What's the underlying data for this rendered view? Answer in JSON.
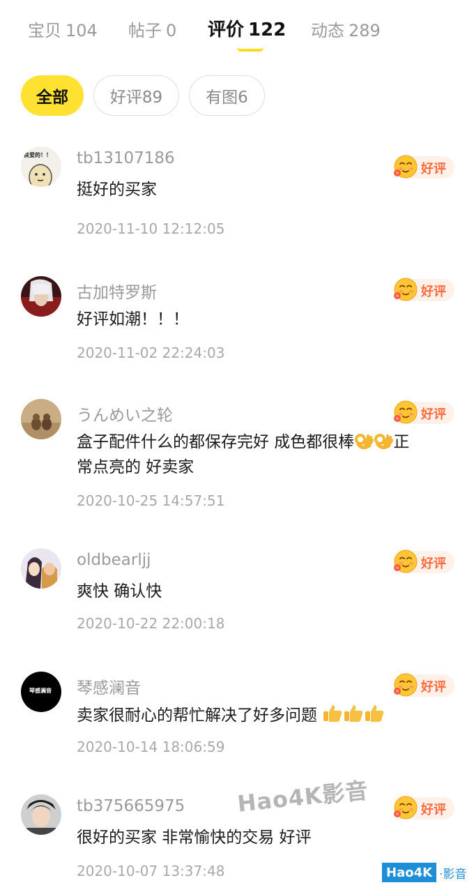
{
  "tabs": [
    {
      "label": "宝贝",
      "count": "104"
    },
    {
      "label": "帖子",
      "count": "0"
    },
    {
      "label": "评价",
      "count": "122"
    },
    {
      "label": "动态",
      "count": "289"
    }
  ],
  "active_tab": "评价",
  "filters": [
    {
      "label": "全部"
    },
    {
      "label": "好评89"
    },
    {
      "label": "有图6"
    }
  ],
  "reviews": [
    {
      "username": "tb13107186",
      "content": "挺好的买家",
      "date": "2020-11-10 12:12:05",
      "badge": "好评",
      "avatar_text": "良爱的！！"
    },
    {
      "username": "古加特罗斯",
      "content": "好评如潮！！！",
      "date": "2020-11-02 22:24:03",
      "badge": "好评"
    },
    {
      "username": "うんめい之轮",
      "content_line1": "盒子配件什么的都保存完好 成色都很棒",
      "content_line1_end": "正",
      "content_line2": "常点亮的 好卖家",
      "date": "2020-10-25 14:57:51",
      "badge": "好评"
    },
    {
      "username": "oldbearljj",
      "content": "爽快 确认快",
      "date": "2020-10-22 22:00:18",
      "badge": "好评"
    },
    {
      "username": "琴感澜音",
      "content": "卖家很耐心的帮忙解决了好多问题",
      "date": "2020-10-14 18:06:59",
      "badge": "好评",
      "avatar_text": "琴感澜音"
    },
    {
      "username": "tb375665975",
      "content": "很好的买家 非常愉快的交易 好评",
      "date": "2020-10-07 13:37:48",
      "badge": "好评"
    }
  ],
  "watermark": {
    "center": "Hao4K影音",
    "corner_box": "Hao4K",
    "corner_text": "·影音"
  },
  "colors": {
    "accent_yellow": "#ffe131",
    "badge_text": "#ff6a3d",
    "badge_bg": "#fdf1e9",
    "muted": "#9a9a9a"
  }
}
